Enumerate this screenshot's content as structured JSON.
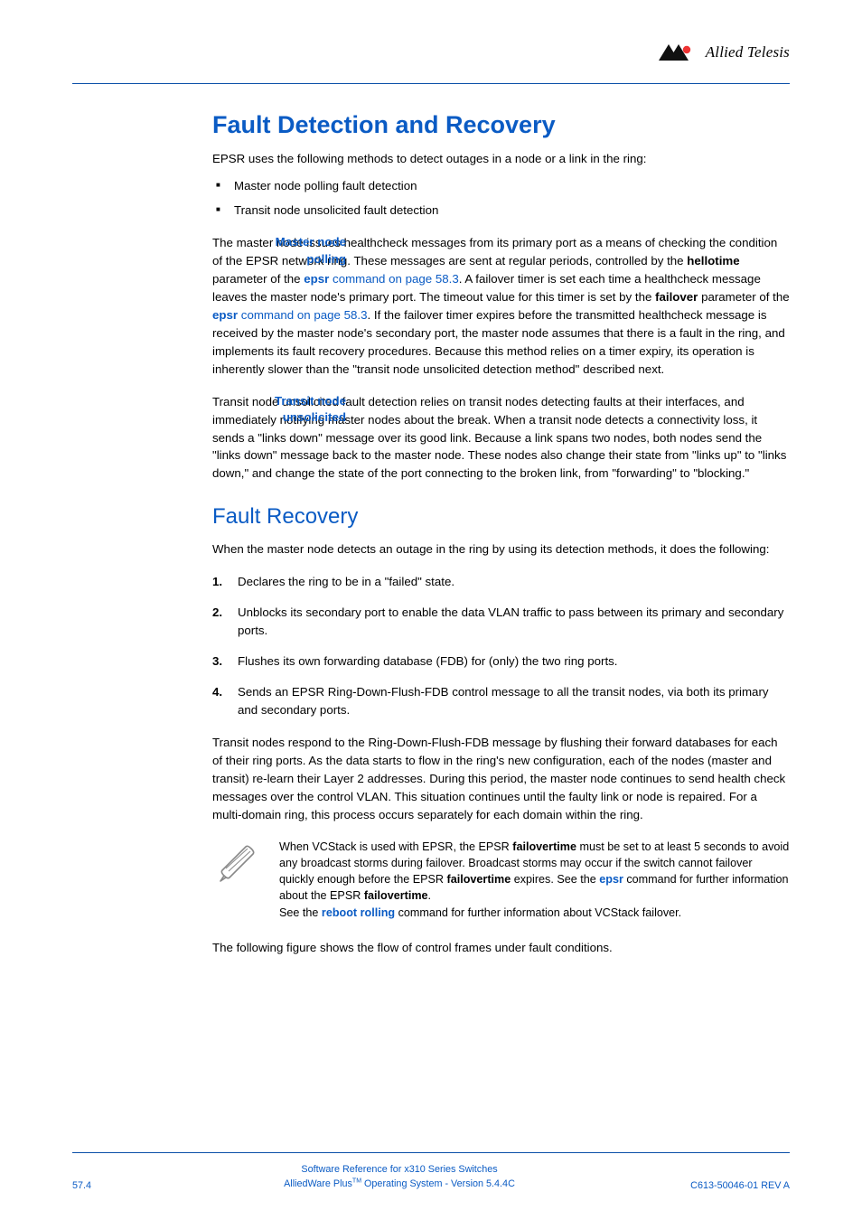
{
  "brand": {
    "name": "Allied Telesis"
  },
  "h1": "Fault Detection and Recovery",
  "intro": "EPSR uses the following methods to detect outages in a node or a link in the ring:",
  "bullets": [
    "Master node polling fault detection",
    "Transit node unsolicited fault detection"
  ],
  "sections": {
    "masterPolling": {
      "label1": "Master node",
      "label2": "polling",
      "p1a": "The master node issues healthcheck messages from its primary port as a means of checking the condition of the EPSR network ring. These messages are sent at regular periods, controlled by the ",
      "hellotime": "hellotime",
      "p1b": " parameter of the ",
      "epsrLink1": "epsr",
      "cmdLink1": " command on page 58.3",
      "p1c": ". A failover timer is set each time a healthcheck message leaves the master node's primary port. The timeout value for this timer is set by the ",
      "failover": "failover",
      "p1d": " parameter of the ",
      "epsrLink2": "epsr",
      "cmdLink2": "command on page 58.3",
      "p1e": ". If the failover timer expires before the transmitted healthcheck message is received by the master node's secondary port, the master node assumes that there is a fault in the ring, and implements its fault recovery procedures. Because this method relies on a timer expiry, its operation is inherently slower than the \"transit node unsolicited detection method\" described next."
    },
    "transitUnsolicited": {
      "label1": "Transit node",
      "label2": "unsolicited",
      "p": "Transit node unsolicited fault detection relies on transit nodes detecting faults at their interfaces, and immediately notifying master nodes about the break. When a transit node detects a connectivity loss, it sends a \"links down\" message over its good link. Because a link spans two nodes, both nodes send the \"links down\" message back to the master node. These nodes also change their state from \"links up\" to \"links down,\" and change the state of the port connecting to the broken link, from \"forwarding\" to \"blocking.\""
    },
    "recovery": {
      "h2": "Fault Recovery",
      "intro": "When the master node detects an outage in the ring by using its detection methods, it does the following:",
      "steps": [
        "Declares the ring to be in a \"failed\" state.",
        "Unblocks its secondary port to enable the data VLAN traffic to pass between its primary and secondary ports.",
        "Flushes its own forwarding database (FDB) for (only) the two ring ports.",
        "Sends an EPSR Ring-Down-Flush-FDB control message to all the transit nodes, via both its primary and secondary ports."
      ],
      "after": "Transit nodes respond to the Ring-Down-Flush-FDB message by flushing their forward databases for each of their ring ports. As the data starts to flow in the ring's new configuration, each of the nodes (master and transit) re-learn their Layer 2 addresses. During this period, the master node continues to send health check messages over the control VLAN. This situation continues until the faulty link or node is repaired. For a multi-domain ring, this process occurs separately for each domain within the ring."
    },
    "note": {
      "a": "When VCStack is used with EPSR, the EPSR ",
      "b": "failovertime",
      "c": " must be set to at least 5 seconds to avoid any broadcast storms during failover. Broadcast storms may occur if the switch cannot failover quickly enough before the EPSR ",
      "d": "failovertime",
      "e": " expires. See the ",
      "f": "epsr",
      "g": " command for further information about the EPSR ",
      "h": "failovertime",
      "i": ".",
      "j": "See the ",
      "k": "reboot rolling",
      "l": " command for further information about VCStack failover."
    },
    "closing": "The following figure shows the flow of control frames under fault conditions."
  },
  "footer": {
    "pageNum": "57.4",
    "line1": "Software Reference for x310 Series Switches",
    "line2a": "AlliedWare Plus",
    "line2b": " Operating System  - Version 5.4.4C",
    "rev": "C613-50046-01 REV A"
  }
}
